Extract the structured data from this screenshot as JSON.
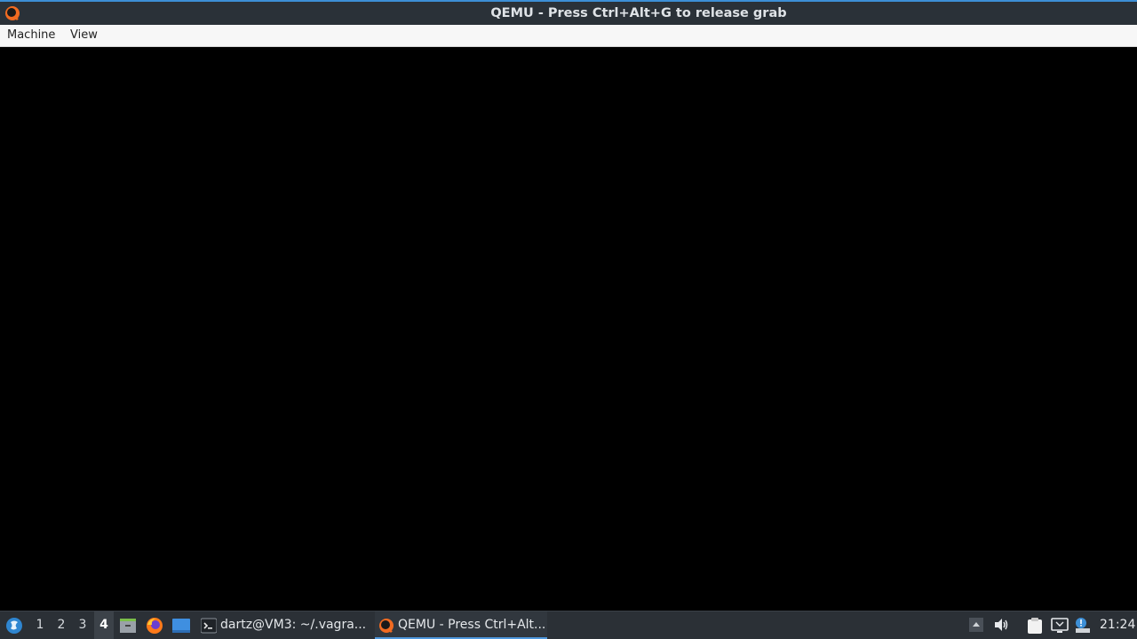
{
  "window": {
    "title": "QEMU - Press Ctrl+Alt+G to release grab",
    "app_icon": "qemu-icon"
  },
  "menubar": {
    "items": [
      "Machine",
      "View"
    ]
  },
  "taskbar": {
    "start_icon": "start-menu-icon",
    "desktops": [
      "1",
      "2",
      "3",
      "4"
    ],
    "active_desktop": "4",
    "launchers": [
      "file-manager-icon",
      "firefox-icon",
      "show-desktop-icon"
    ],
    "tasks": [
      {
        "icon": "terminal-icon",
        "label": "dartz@VM3: ~/.vagra..."
      },
      {
        "icon": "qemu-icon",
        "label": "QEMU - Press Ctrl+Alt..."
      }
    ],
    "active_task": 1,
    "tray_icons": [
      "tray-expand-icon",
      "volume-icon",
      "clipboard-icon",
      "network-icon",
      "notification-icon"
    ],
    "clock": "21:24"
  },
  "colors": {
    "titlebar": "#2a3138",
    "accent": "#3d8fd6",
    "menubar": "#f7f7f7",
    "guest_screen": "#000000",
    "taskbar": "#2b3036"
  }
}
